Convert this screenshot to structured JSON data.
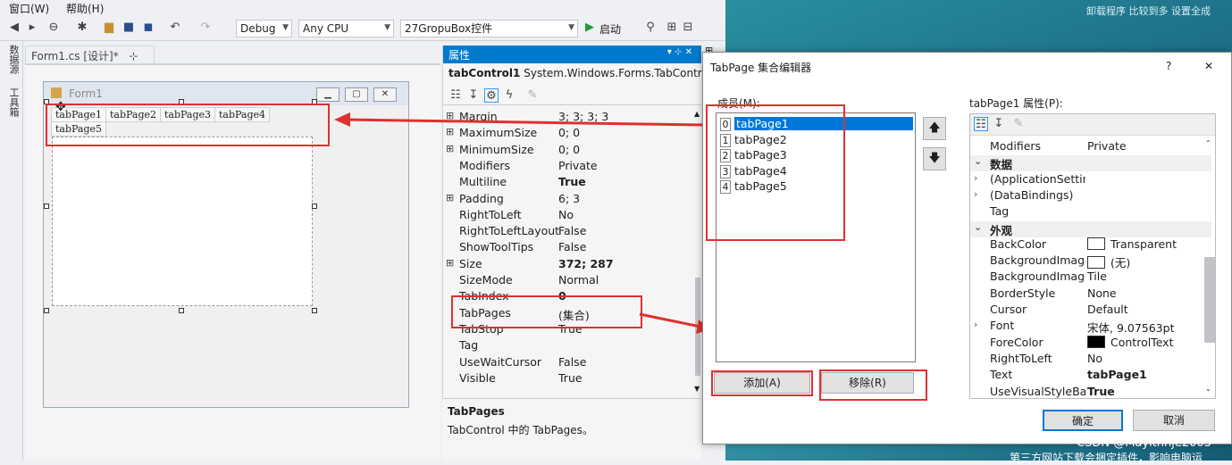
{
  "menu": {
    "window": "窗口(W)",
    "help": "帮助(H)"
  },
  "toolbar": {
    "config": "Debug",
    "platform": "Any CPU",
    "project": "27GropuBox控件",
    "start": "启动"
  },
  "side": {
    "tab1": "数据源",
    "tab2": "工具箱"
  },
  "doc": {
    "tab_label": "Form1.cs [设计]*",
    "pin": "⊹",
    "close": "✕"
  },
  "form": {
    "title": "Form1",
    "tabs": [
      "tabPage1",
      "tabPage2",
      "tabPage3",
      "tabPage4",
      "tabPage5"
    ]
  },
  "props": {
    "header": "属性",
    "object_name": "tabControl1",
    "object_type": "System.Windows.Forms.TabContr",
    "rows": [
      {
        "exp": "⊞",
        "name": "Margin",
        "value": "3; 3; 3; 3"
      },
      {
        "exp": "⊞",
        "name": "MaximumSize",
        "value": "0; 0"
      },
      {
        "exp": "⊞",
        "name": "MinimumSize",
        "value": "0; 0"
      },
      {
        "exp": "",
        "name": "Modifiers",
        "value": "Private"
      },
      {
        "exp": "",
        "name": "Multiline",
        "value": "True",
        "bold": true
      },
      {
        "exp": "⊞",
        "name": "Padding",
        "value": "6; 3"
      },
      {
        "exp": "",
        "name": "RightToLeft",
        "value": "No"
      },
      {
        "exp": "",
        "name": "RightToLeftLayout",
        "value": "False"
      },
      {
        "exp": "",
        "name": "ShowToolTips",
        "value": "False"
      },
      {
        "exp": "⊞",
        "name": "Size",
        "value": "372; 287",
        "bold": true
      },
      {
        "exp": "",
        "name": "SizeMode",
        "value": "Normal"
      },
      {
        "exp": "",
        "name": "TabIndex",
        "value": "0",
        "bold": true
      },
      {
        "exp": "",
        "name": "TabPages",
        "value": "(集合)"
      },
      {
        "exp": "",
        "name": "TabStop",
        "value": "True"
      },
      {
        "exp": "",
        "name": "Tag",
        "value": ""
      },
      {
        "exp": "",
        "name": "UseWaitCursor",
        "value": "False"
      },
      {
        "exp": "",
        "name": "Visible",
        "value": "True"
      }
    ],
    "desc_title": "TabPages",
    "desc_text": "TabControl 中的 TabPages。"
  },
  "dialog": {
    "title": "TabPage 集合编辑器",
    "help": "?",
    "close": "✕",
    "members_label": "成员(M):",
    "members": [
      {
        "idx": "0",
        "name": "tabPage1"
      },
      {
        "idx": "1",
        "name": "tabPage2"
      },
      {
        "idx": "2",
        "name": "tabPage3"
      },
      {
        "idx": "3",
        "name": "tabPage4"
      },
      {
        "idx": "4",
        "name": "tabPage5"
      }
    ],
    "selected_index": 0,
    "up": "🡅",
    "down": "🡇",
    "props_label": "tabPage1 属性(P):",
    "grid": [
      {
        "exp": "",
        "name": "Modifiers",
        "value": "Private"
      },
      {
        "exp": "⌄",
        "name": "数据",
        "value": "",
        "cat": true
      },
      {
        "exp": "›",
        "name": "(ApplicationSettin",
        "value": ""
      },
      {
        "exp": "›",
        "name": "(DataBindings)",
        "value": ""
      },
      {
        "exp": "",
        "name": "Tag",
        "value": ""
      },
      {
        "exp": "⌄",
        "name": "外观",
        "value": "",
        "cat": true
      },
      {
        "exp": "",
        "name": "BackColor",
        "value": "Transparent",
        "swatch": "#ffffff"
      },
      {
        "exp": "",
        "name": "BackgroundImage",
        "value": "(无)",
        "swatch": "#ffffff"
      },
      {
        "exp": "",
        "name": "BackgroundImage",
        "value": "Tile"
      },
      {
        "exp": "",
        "name": "BorderStyle",
        "value": "None"
      },
      {
        "exp": "",
        "name": "Cursor",
        "value": "Default"
      },
      {
        "exp": "›",
        "name": "Font",
        "value": "宋体, 9.07563pt"
      },
      {
        "exp": "",
        "name": "ForeColor",
        "value": "ControlText",
        "swatch": "#000000"
      },
      {
        "exp": "",
        "name": "RightToLeft",
        "value": "No"
      },
      {
        "exp": "",
        "name": "Text",
        "value": "tabPage1",
        "bold": true
      },
      {
        "exp": "",
        "name": "UseVisualStyleBac",
        "value": "True",
        "bold": true
      }
    ],
    "add": "添加(A)",
    "remove": "移除(R)",
    "ok": "确定",
    "cancel": "取消"
  },
  "watermark": "CSDN @Mayitnhje2003",
  "bottom_text": "第三方网站下载会捆定插件，影响电脑运",
  "desktop_text": "卸载程序  比较到多  设置全成"
}
